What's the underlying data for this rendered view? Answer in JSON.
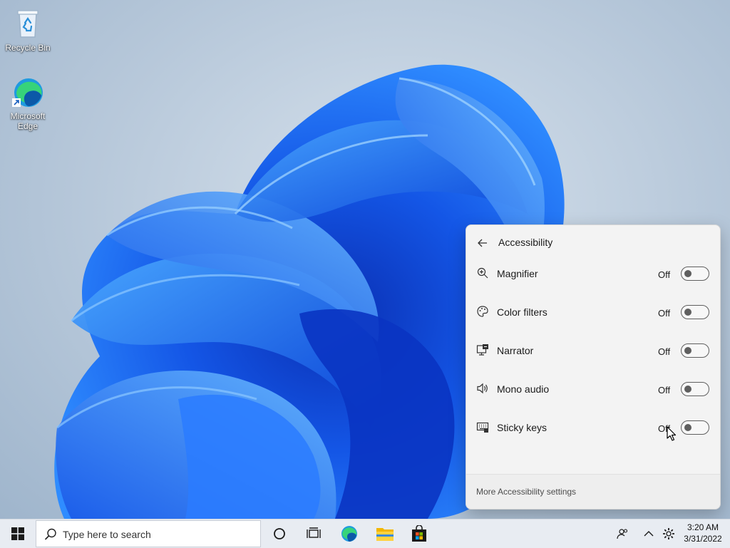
{
  "desktop": {
    "icons": [
      {
        "label": "Recycle Bin",
        "icon": "recycle-bin-icon"
      },
      {
        "label": "Microsoft Edge",
        "icon": "edge-icon"
      }
    ]
  },
  "flyout": {
    "title": "Accessibility",
    "items": [
      {
        "label": "Magnifier",
        "state": "Off",
        "icon": "magnifier-icon"
      },
      {
        "label": "Color filters",
        "state": "Off",
        "icon": "color-filters-icon"
      },
      {
        "label": "Narrator",
        "state": "Off",
        "icon": "narrator-icon"
      },
      {
        "label": "Mono audio",
        "state": "Off",
        "icon": "mono-audio-icon"
      },
      {
        "label": "Sticky keys",
        "state": "Off",
        "icon": "sticky-keys-icon"
      }
    ],
    "footer_link": "More Accessibility settings"
  },
  "taskbar": {
    "search_placeholder": "Type here to search",
    "time": "3:20 AM",
    "date": "3/31/2022",
    "apps": [
      "cortana-icon",
      "task-view-icon",
      "edge-icon",
      "file-explorer-icon",
      "microsoft-store-icon"
    ],
    "tray": [
      "people-icon",
      "chevron-up-icon",
      "settings-gear-icon"
    ]
  },
  "colors": {
    "accent": "#0078d4",
    "toggle_off": "#5f5f5f",
    "flyout_bg": "#f3f3f3"
  }
}
